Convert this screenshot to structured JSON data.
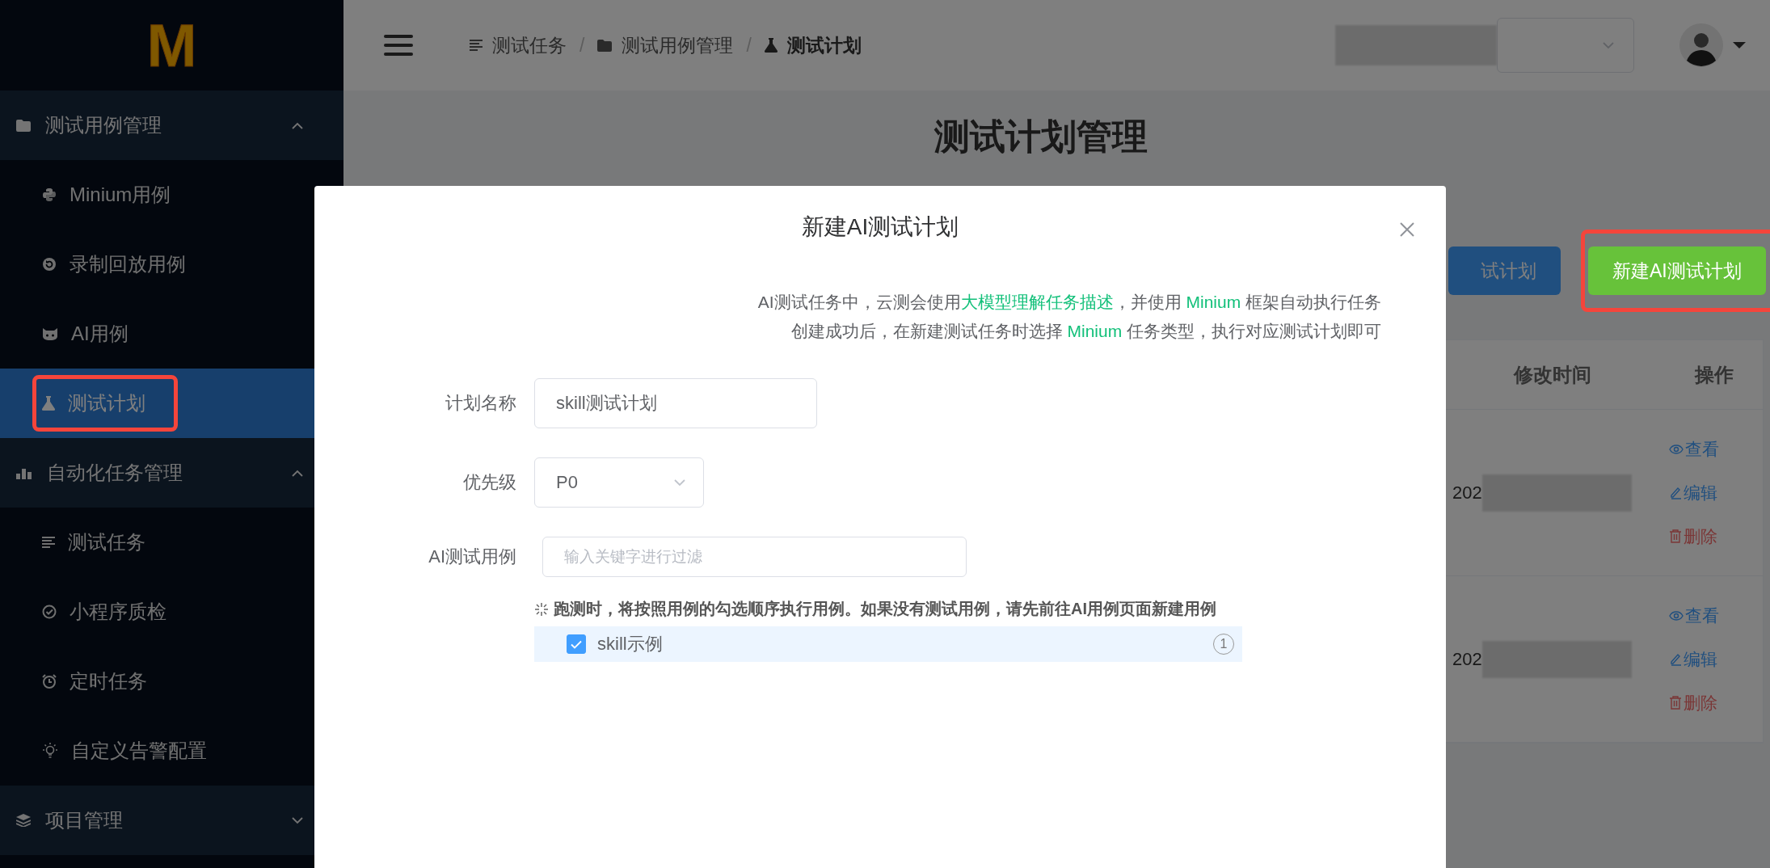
{
  "sidebar": {
    "logo": "M",
    "groups": [
      {
        "label": "测试用例管理",
        "expanded": true,
        "items": [
          {
            "label": "Minium用例",
            "selected": false,
            "highlighted": false
          },
          {
            "label": "录制回放用例",
            "selected": false,
            "highlighted": false
          },
          {
            "label": "AI用例",
            "selected": false,
            "highlighted": false
          },
          {
            "label": "测试计划",
            "selected": true,
            "highlighted": true
          }
        ]
      },
      {
        "label": "自动化任务管理",
        "expanded": true,
        "items": [
          {
            "label": "测试任务",
            "selected": false,
            "highlighted": false
          },
          {
            "label": "小程序质检",
            "selected": false,
            "highlighted": false
          },
          {
            "label": "定时任务",
            "selected": false,
            "highlighted": false
          },
          {
            "label": "自定义告警配置",
            "selected": false,
            "highlighted": false
          }
        ]
      },
      {
        "label": "项目管理",
        "expanded": false
      }
    ]
  },
  "header": {
    "separator": "/",
    "breadcrumb": [
      {
        "label": "测试任务",
        "current": false
      },
      {
        "label": "测试用例管理",
        "current": false
      },
      {
        "label": "测试计划",
        "current": true
      }
    ]
  },
  "page": {
    "title": "测试计划管理",
    "buttons": [
      {
        "label": "试计划",
        "kind": "primary",
        "highlighted": false
      },
      {
        "label": "新建AI测试计划",
        "kind": "success",
        "highlighted": true
      }
    ],
    "table": {
      "columns": [
        "修改时间",
        "操作"
      ],
      "rows": [
        {
          "modified": "202",
          "actions": [
            {
              "label": "查看",
              "kind": "view"
            },
            {
              "label": "编辑",
              "kind": "edit"
            },
            {
              "label": "删除",
              "kind": "delete"
            }
          ]
        },
        {
          "modified": "202",
          "actions": [
            {
              "label": "查看",
              "kind": "view"
            },
            {
              "label": "编辑",
              "kind": "edit"
            },
            {
              "label": "删除",
              "kind": "delete"
            }
          ]
        }
      ]
    }
  },
  "dialog": {
    "title": "新建AI测试计划",
    "intro": [
      [
        {
          "text": "AI测试任务中，云测会使用",
          "highlight": false
        },
        {
          "text": "大模型理解任务描述",
          "highlight": true
        },
        {
          "text": "，并使用 ",
          "highlight": false
        },
        {
          "text": "Minium",
          "highlight": true
        },
        {
          "text": " 框架自动执行任务",
          "highlight": false
        }
      ],
      [
        {
          "text": "创建成功后，在新建测试任务时选择 ",
          "highlight": false
        },
        {
          "text": "Minium",
          "highlight": true
        },
        {
          "text": " 任务类型，执行对应测试计划即可",
          "highlight": false
        }
      ]
    ],
    "fields": [
      {
        "label": "计划名称",
        "kind": "text",
        "value": "skill测试计划"
      },
      {
        "label": "优先级",
        "kind": "select",
        "value": "P0"
      },
      {
        "label": "AI测试用例",
        "kind": "filter",
        "placeholder": "输入关键字进行过滤"
      }
    ],
    "hint": "跑测时，将按照用例的勾选顺序执行用例。如果没有测试用例，请先前往AI用例页面新建用例",
    "cases": [
      {
        "label": "skill示例",
        "checked": true,
        "order": "1"
      }
    ]
  }
}
